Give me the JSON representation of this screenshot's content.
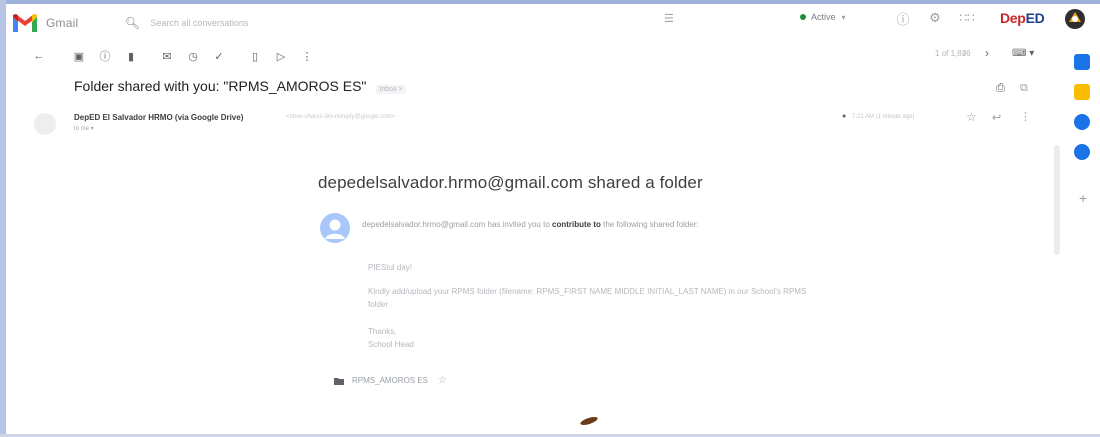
{
  "app": {
    "name": "Gmail",
    "search_placeholder": "Search all conversations",
    "status": "Active",
    "org_logo_left": "Dep",
    "org_logo_right": "ED"
  },
  "toolbar": {
    "pager": "1 of 1,836"
  },
  "email": {
    "subject": "Folder shared with you: \"RPMS_AMOROS ES\"",
    "label": "Inbox ×",
    "sender_name": "DepED El Salvador HRMO (via Google Drive)",
    "sender_email": "<drive-shares-dm-noreply@google.com>",
    "recipient": "to me ▾",
    "timestamp": "7:21 AM (1 minute ago)"
  },
  "body": {
    "headline": "depedelsalvador.hrmo@gmail.com shared a folder",
    "invite_prefix": "depedelsalvador.hrmo@gmail.com has invited you to ",
    "invite_bold": "contribute to",
    "invite_suffix": " the following shared folder:",
    "greeting": "PIEStul day!",
    "instruction": "Kindly add/upload your RPMS folder (filename: RPMS_FIRST NAME MIDDLE INITIAL_LAST NAME) in our School's RPMS folder",
    "thanks": "Thanks,",
    "signature": "School Head",
    "folder_name": "RPMS_AMOROS ES"
  },
  "colors": {
    "active_dot": "#1e8e3e",
    "deped_red": "#c62828",
    "deped_blue": "#1e3f8a",
    "calendar": "#1a73e8",
    "keep": "#fbbc04",
    "tasks": "#1a73e8",
    "contacts": "#1a73e8"
  }
}
